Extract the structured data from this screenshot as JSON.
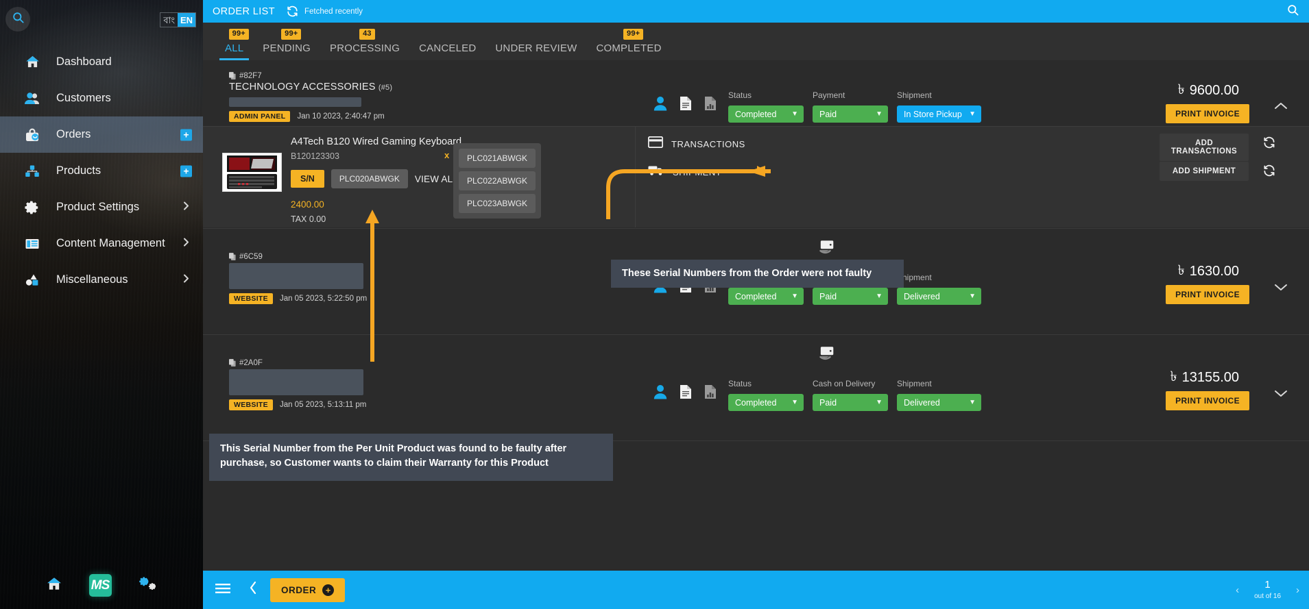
{
  "sidebar": {
    "search_icon": "search-icon",
    "language": {
      "options": [
        "বাং",
        "EN"
      ],
      "selected": "EN"
    },
    "items": [
      {
        "label": "Dashboard",
        "icon": "home-icon",
        "active": false,
        "chevron": false,
        "plus": false
      },
      {
        "label": "Customers",
        "icon": "users-icon",
        "active": false,
        "chevron": false,
        "plus": false
      },
      {
        "label": "Orders",
        "icon": "bag-icon",
        "active": true,
        "chevron": false,
        "plus": true
      },
      {
        "label": "Products",
        "icon": "boxes-icon",
        "active": false,
        "chevron": false,
        "plus": true
      },
      {
        "label": "Product Settings",
        "icon": "gear-icon",
        "active": false,
        "chevron": true,
        "plus": false
      },
      {
        "label": "Content Management",
        "icon": "newspaper-icon",
        "active": false,
        "chevron": true,
        "plus": false
      },
      {
        "label": "Miscellaneous",
        "icon": "shapes-icon",
        "active": false,
        "chevron": true,
        "plus": false
      }
    ],
    "footer": {
      "home_icon": "home-icon",
      "logo_text": "MS",
      "settings_icon": "gears-icon"
    }
  },
  "topbar": {
    "title": "ORDER LIST",
    "refresh_icon": "refresh-icon",
    "fetch_status": "Fetched recently",
    "search_icon": "search-icon"
  },
  "tabs": [
    {
      "label": "ALL",
      "badge": "99+",
      "active": true
    },
    {
      "label": "PENDING",
      "badge": "99+",
      "active": false
    },
    {
      "label": "PROCESSING",
      "badge": "43",
      "active": false
    },
    {
      "label": "CANCELED",
      "badge": "",
      "active": false
    },
    {
      "label": "UNDER REVIEW",
      "badge": "",
      "active": false
    },
    {
      "label": "COMPLETED",
      "badge": "99+",
      "active": false
    }
  ],
  "labels": {
    "status": "Status",
    "payment": "Payment",
    "shipment": "Shipment",
    "cash_on_delivery": "Cash on Delivery",
    "print_invoice": "PRINT INVOICE",
    "transactions": "TRANSACTIONS",
    "shipment_section": "SHIPMENT",
    "add_transactions": "ADD TRANSACTIONS",
    "add_shipment": "ADD SHIPMENT",
    "currency": "৳"
  },
  "orders": [
    {
      "id": "#82F7",
      "title": "TECHNOLOGY ACCESSORIES",
      "title_sub": "(#5)",
      "tag": "ADMIN PANEL",
      "date": "Jan 10 2023, 2:40:47 pm",
      "status": "Completed",
      "payment": "Paid",
      "shipment": "In Store Pickup",
      "shipment_color": "blue",
      "payment_label": "Payment",
      "amount": "9600.00",
      "expanded": true
    },
    {
      "id": "#6C59",
      "title": "",
      "title_sub": "",
      "tag": "WEBSITE",
      "date": "Jan 05 2023, 5:22:50 pm",
      "status": "Completed",
      "payment": "Paid",
      "shipment": "Delivered",
      "shipment_color": "green",
      "payment_label": "Cash on Delivery",
      "amount": "1630.00",
      "expanded": false
    },
    {
      "id": "#2A0F",
      "title": "",
      "title_sub": "",
      "tag": "WEBSITE",
      "date": "Jan 05 2023, 5:13:11 pm",
      "status": "Completed",
      "payment": "Paid",
      "shipment": "Delivered",
      "shipment_color": "green",
      "payment_label": "Cash on Delivery",
      "amount": "13155.00",
      "expanded": false
    }
  ],
  "product": {
    "name": "A4Tech B120 Wired Gaming Keyboard",
    "sku": "B120123303",
    "qty_marker": "x",
    "sn_badge": "S/N",
    "serial_visible": "PLC020ABWGK",
    "view_all": "VIEW ALL (3)",
    "price": "2400.00",
    "tax": "TAX 0.00",
    "serials_popup": [
      "PLC021ABWGK",
      "PLC022ABWGK",
      "PLC023ABWGK"
    ]
  },
  "annotations": [
    {
      "text": "These Serial Numbers from the Order were not faulty"
    },
    {
      "text": "This Serial Number from the Per Unit Product was found to be faulty after purchase, so Customer wants to claim their Warranty for this Product"
    }
  ],
  "footer": {
    "menu_icon": "hamburger-icon",
    "back_icon": "chevron-left-icon",
    "order_button": "ORDER",
    "order_plus": "+",
    "page_prev": "‹",
    "page_number": "1",
    "page_total": "out of 16",
    "page_next": "›"
  },
  "colors": {
    "accent_blue": "#11aaf0",
    "accent_yellow": "#f5b324",
    "success_green": "#4caf50",
    "annotation_bg": "#414854"
  }
}
